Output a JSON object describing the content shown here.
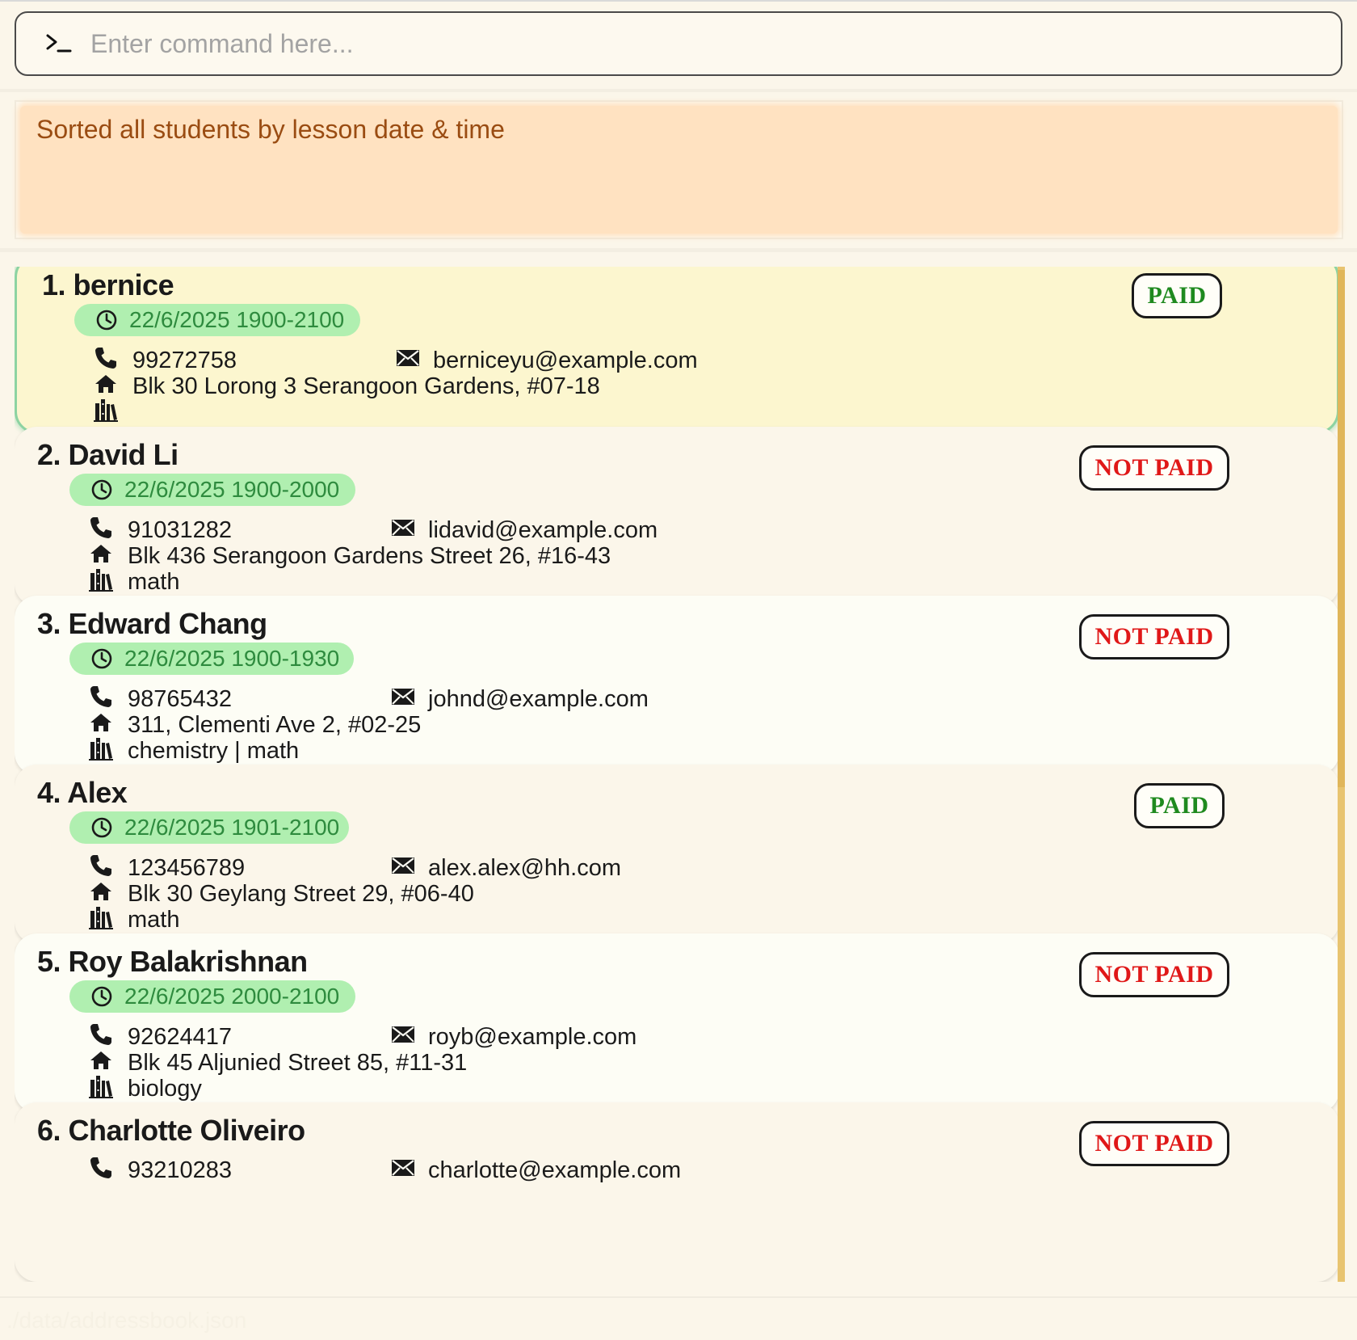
{
  "command": {
    "placeholder": "Enter command here...",
    "value": "",
    "prompt_icon": "terminal-prompt-icon"
  },
  "result": {
    "message": "Sorted all students by lesson date & time"
  },
  "students": [
    {
      "index": "1.",
      "name": "bernice",
      "lesson": "22/6/2025 1900-2100",
      "phone": "99272758",
      "email": "berniceyu@example.com",
      "address": "Blk 30 Lorong 3 Serangoon Gardens, #07-18",
      "subjects": "",
      "status": "PAID"
    },
    {
      "index": "2.",
      "name": "David Li",
      "lesson": "22/6/2025 1900-2000",
      "phone": "91031282",
      "email": "lidavid@example.com",
      "address": "Blk 436 Serangoon Gardens Street 26, #16-43",
      "subjects": "math",
      "status": "NOT PAID"
    },
    {
      "index": "3.",
      "name": "Edward Chang",
      "lesson": "22/6/2025 1900-1930",
      "phone": "98765432",
      "email": "johnd@example.com",
      "address": "311, Clementi Ave 2, #02-25",
      "subjects": "chemistry | math",
      "status": "NOT PAID"
    },
    {
      "index": "4.",
      "name": "Alex",
      "lesson": "22/6/2025 1901-2100",
      "phone": "123456789",
      "email": "alex.alex@hh.com",
      "address": "Blk 30 Geylang Street 29, #06-40",
      "subjects": "math",
      "status": "PAID"
    },
    {
      "index": "5.",
      "name": "Roy Balakrishnan",
      "lesson": "22/6/2025 2000-2100",
      "phone": "92624417",
      "email": "royb@example.com",
      "address": "Blk 45 Aljunied Street 85, #11-31",
      "subjects": "biology",
      "status": "NOT PAID"
    },
    {
      "index": "6.",
      "name": "Charlotte Oliveiro",
      "lesson": "",
      "phone": "93210283",
      "email": "charlotte@example.com",
      "address": "",
      "subjects": "",
      "status": "NOT PAID"
    }
  ],
  "status_bar": {
    "path": "./data/addressbook.json"
  },
  "colors": {
    "paid": "#1f8a1f",
    "not_paid": "#e01818",
    "lesson_pill": "#b0efb0",
    "lesson_text": "#2e8b3e",
    "result_bg": "#ffe2c1",
    "result_text": "#9a4c12",
    "selected_card": "#fcf6cf",
    "selected_border": "#8dd3a2"
  }
}
